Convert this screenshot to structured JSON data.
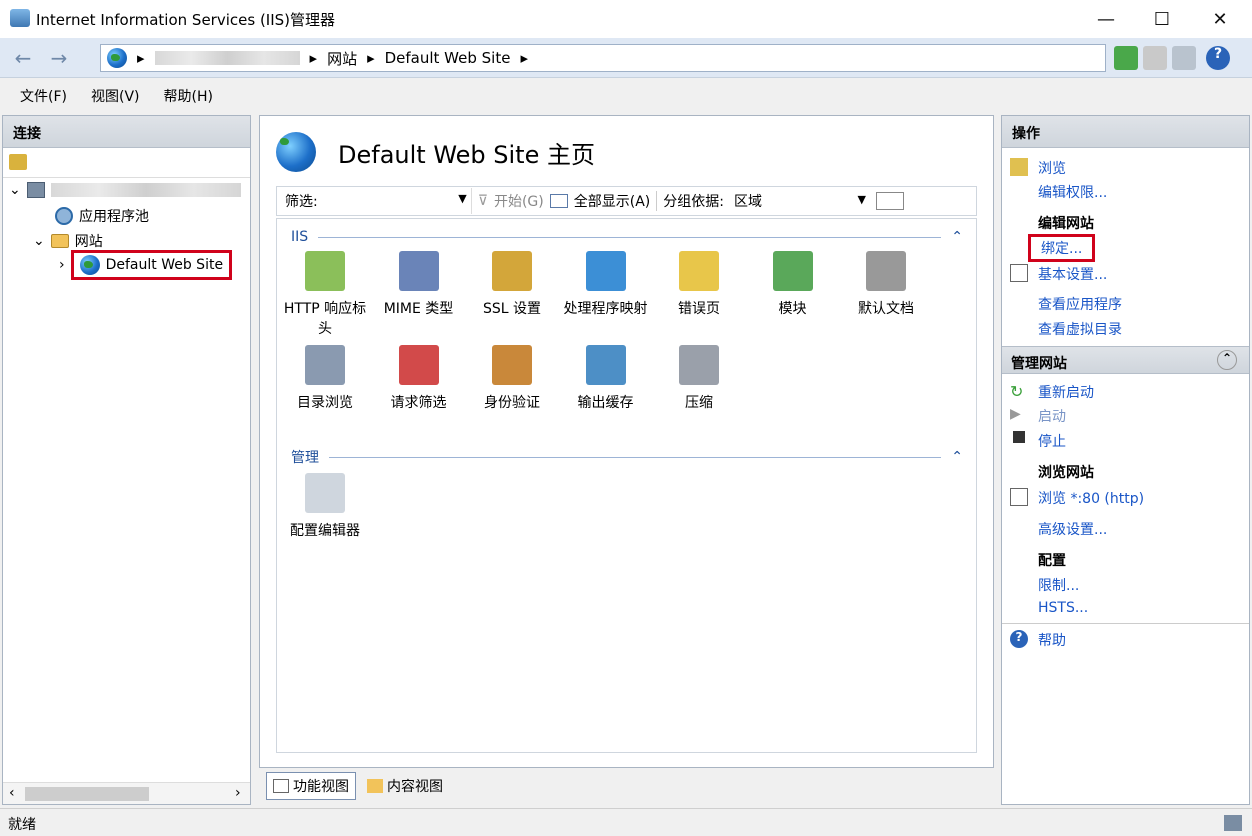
{
  "window": {
    "title": "Internet Information Services (IIS)管理器"
  },
  "address": {
    "crumbs": [
      "网站",
      "Default Web Site"
    ]
  },
  "menu": [
    "文件(F)",
    "视图(V)",
    "帮助(H)"
  ],
  "connections": {
    "header": "连接",
    "tree": {
      "app_pools": "应用程序池",
      "sites": "网站",
      "selected_site": "Default Web Site"
    }
  },
  "center": {
    "title": "Default Web Site 主页",
    "filter": {
      "label": "筛选:",
      "start": "开始(G)",
      "show_all": "全部显示(A)",
      "group_label": "分组依据:",
      "group_value": "区域"
    },
    "groups": [
      {
        "name": "IIS",
        "features": [
          "HTTP 响应标头",
          "MIME 类型",
          "SSL 设置",
          "处理程序映射",
          "错误页",
          "模块",
          "默认文档",
          "目录浏览",
          "请求筛选",
          "身份验证",
          "输出缓存",
          "压缩"
        ]
      },
      {
        "name": "管理",
        "features": [
          "配置编辑器"
        ]
      }
    ],
    "tabs": [
      "功能视图",
      "内容视图"
    ]
  },
  "actions": {
    "header": "操作",
    "browse": "浏览",
    "edit_permissions": "编辑权限...",
    "edit_site": "编辑网站",
    "bindings": "绑定...",
    "basic_settings": "基本设置...",
    "view_apps": "查看应用程序",
    "view_vdirs": "查看虚拟目录",
    "manage_site": "管理网站",
    "restart": "重新启动",
    "start": "启动",
    "stop": "停止",
    "browse_site": "浏览网站",
    "browse_80": "浏览 *:80 (http)",
    "advanced": "高级设置...",
    "config": "配置",
    "limits": "限制...",
    "hsts": "HSTS...",
    "help": "帮助"
  },
  "status": "就绪",
  "colors": {
    "link": "#1a56c7",
    "highlight": "#d0021b"
  }
}
